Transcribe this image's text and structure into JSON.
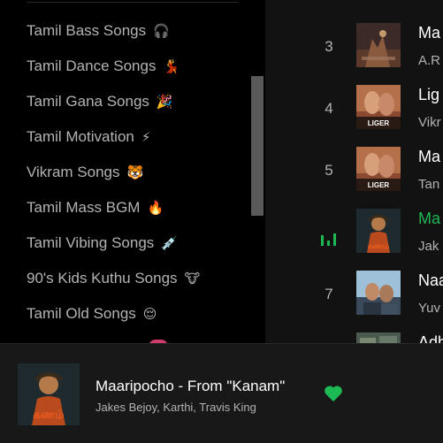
{
  "sidebar": {
    "playlists": [
      {
        "label": "Tamil Bass Songs",
        "emoji": "🎧"
      },
      {
        "label": "Tamil Dance Songs",
        "emoji": "💃"
      },
      {
        "label": "Tamil Gana Songs",
        "emoji": "🎉"
      },
      {
        "label": "Tamil Motivation",
        "emoji": "⚡"
      },
      {
        "label": "Vikram Songs",
        "emoji": "🐯"
      },
      {
        "label": "Tamil Mass BGM",
        "emoji": "🔥"
      },
      {
        "label": "Tamil Vibing Songs",
        "emoji": "💉"
      },
      {
        "label": "90's Kids Kuthu Songs",
        "emoji": "🐮"
      },
      {
        "label": "Tamil Old Songs",
        "emoji": "😌"
      }
    ]
  },
  "tracklist": {
    "rows": [
      {
        "number": "3",
        "title": "Ma",
        "artist": "A.R",
        "art_label": "",
        "playing": false
      },
      {
        "number": "4",
        "title": "Lig",
        "artist": "Vikr",
        "art_label": "LIGER",
        "playing": false
      },
      {
        "number": "5",
        "title": "Ma",
        "artist": "Tan",
        "art_label": "LIGER",
        "playing": false
      },
      {
        "number": "",
        "title": "Ma",
        "artist": "Jak",
        "art_label": "கணம்",
        "playing": true
      },
      {
        "number": "7",
        "title": "Naa",
        "artist": "Yuv",
        "art_label": "",
        "playing": false
      },
      {
        "number": "",
        "title": "Adh",
        "artist": "",
        "art_label": "",
        "playing": false
      }
    ]
  },
  "now_playing": {
    "title": "Maaripocho - From \"Kanam\"",
    "artist": "Jakes Bejoy, Karthi, Travis King",
    "art_label": "கணம்",
    "liked": true
  },
  "colors": {
    "accent": "#1db954",
    "sidebar_bg": "#000000",
    "main_bg": "#121212",
    "player_bg": "#181818"
  },
  "icons": {
    "heart": "heart-icon",
    "now_playing": "equalizer-icon"
  }
}
